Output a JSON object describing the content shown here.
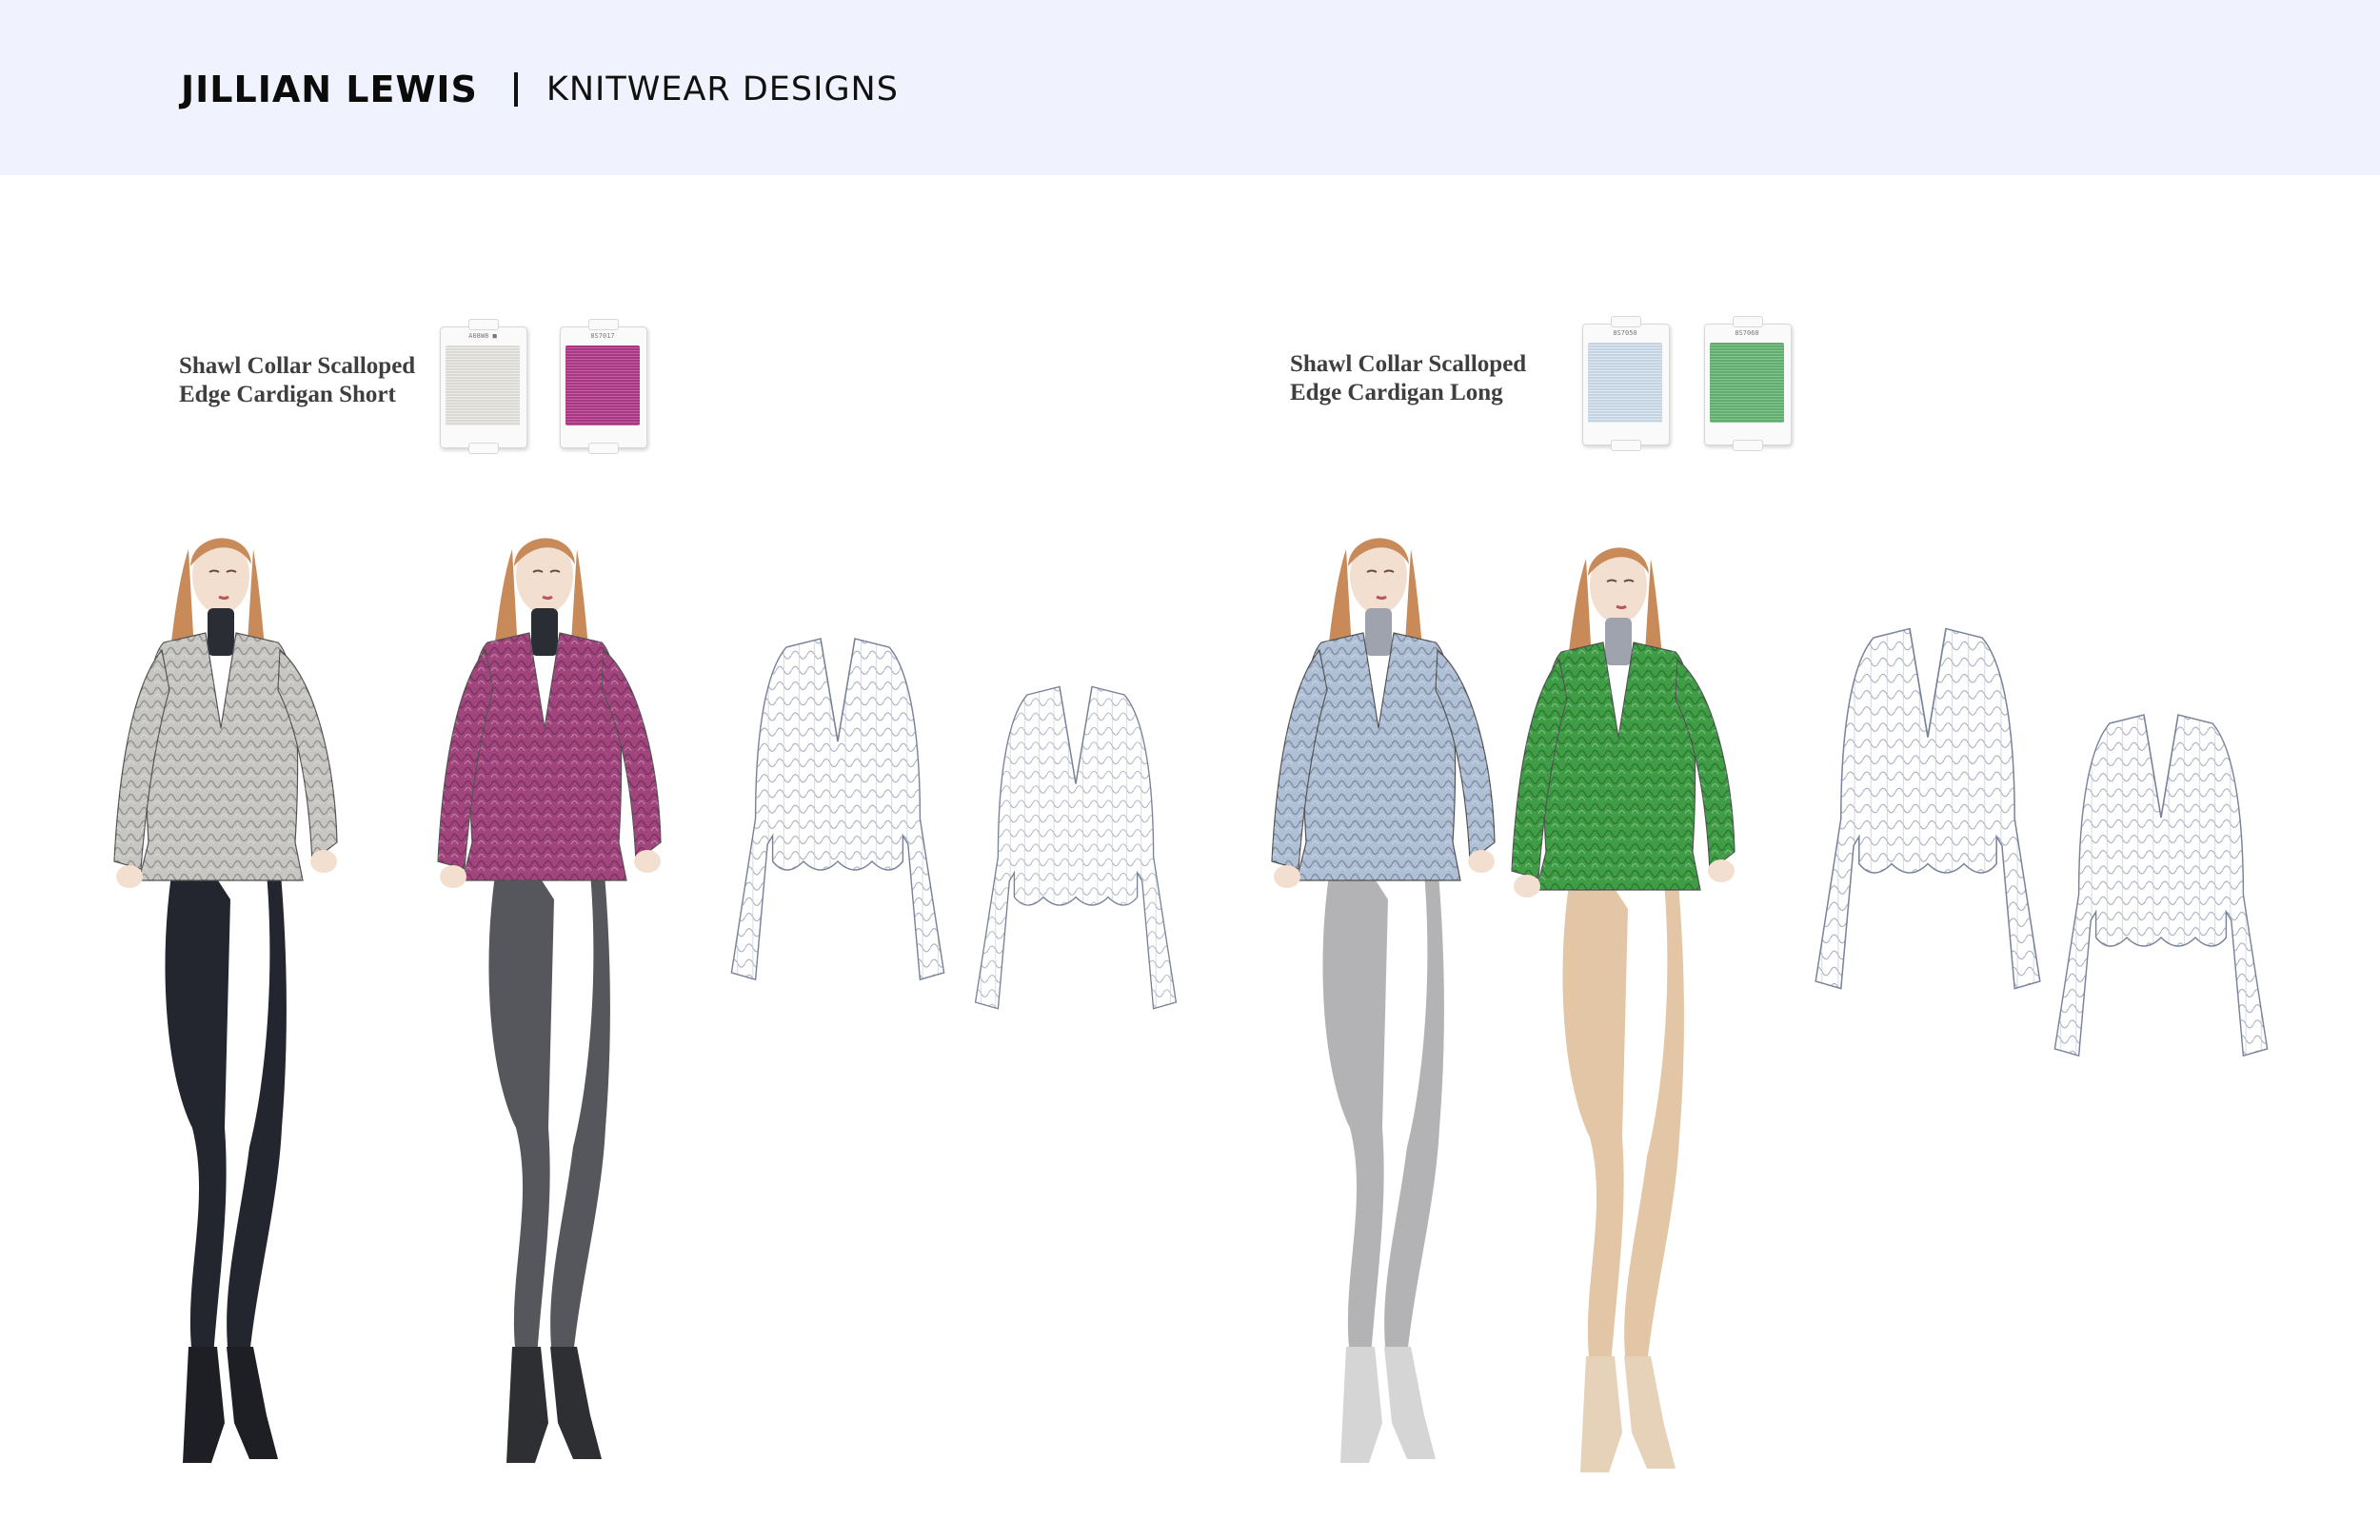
{
  "header": {
    "brand": "JILLIAN LEWIS",
    "subtitle": "KNITWEAR DESIGNS"
  },
  "looks": [
    {
      "title_line1": "Shawl Collar Scalloped",
      "title_line2": "Edge Cardigan Short",
      "swatches": [
        {
          "code": "A08W8 ■",
          "color": "#ebe9e4"
        },
        {
          "code": "8S7017",
          "color": "#b43b8c"
        }
      ],
      "figures": [
        {
          "cardigan": "#c8c6c3",
          "pants": "#23252f",
          "boots": "#1e1f25"
        },
        {
          "cardigan": "#a2457e",
          "pants": "#55575c",
          "boots": "#2e2f33"
        }
      ]
    },
    {
      "title_line1": "Shawl Collar Scalloped",
      "title_line2": "Edge Cardigan Long",
      "swatches": [
        {
          "code": "8S7050",
          "color": "#d4e3f1"
        },
        {
          "code": "8S7060",
          "color": "#6ab978"
        }
      ],
      "figures": [
        {
          "cardigan": "#aebfd6",
          "pants": "#b3b3b5",
          "boots": "#d5d5d5"
        },
        {
          "cardigan": "#3f9e45",
          "pants": "#e2c6a5",
          "boots": "#e6d2b8"
        }
      ]
    }
  ],
  "palette": {
    "header_bg": "#f0f3fd",
    "skin": "#f3dfcf",
    "hair": "#c98a5a",
    "flat_sketch": "#8a93a8"
  },
  "icons": [
    "thread-card-icon",
    "fashion-figure-illustration",
    "flat-sketch-illustration"
  ]
}
